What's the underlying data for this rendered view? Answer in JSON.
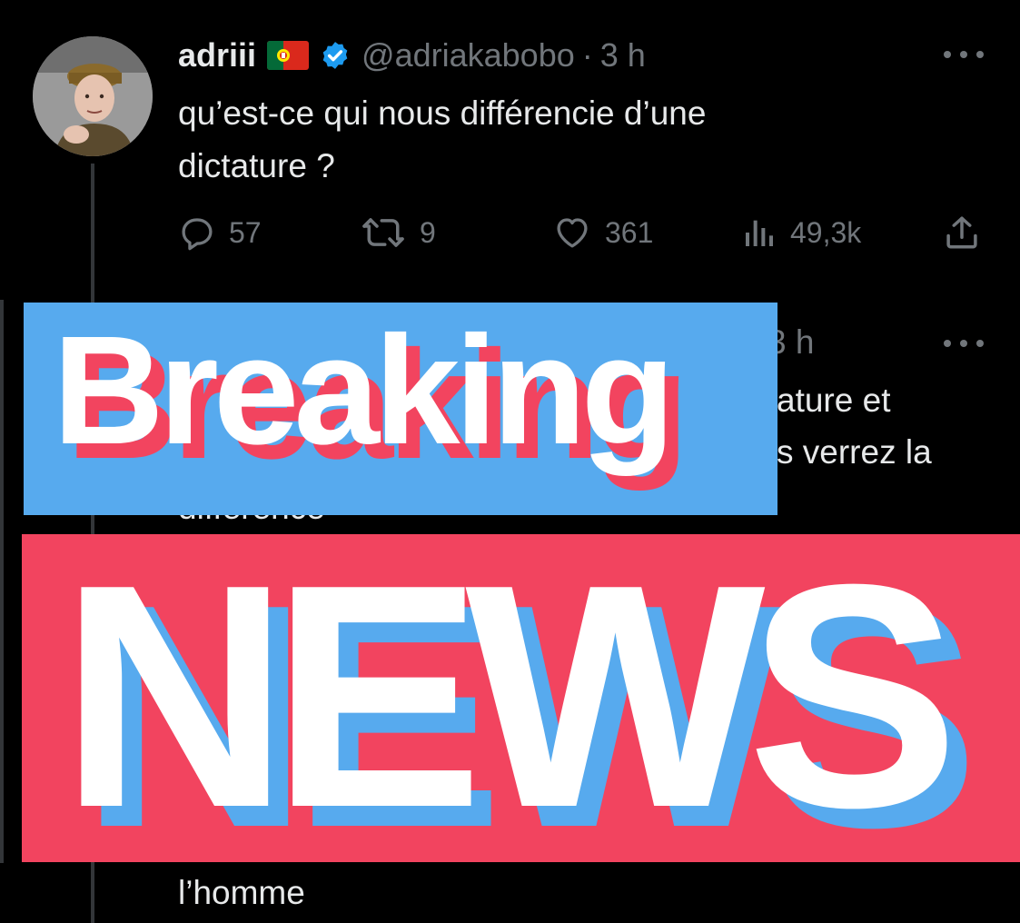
{
  "tweet1": {
    "display_name": "adriii",
    "flag_icon": "portugal-flag-icon",
    "verified_icon": "verified-badge-icon",
    "handle": "@adriakabobo",
    "separator": "·",
    "timestamp": "3 h",
    "text_line1": "qu’est-ce qui nous différencie d’une",
    "text_line2": "dictature ?",
    "actions": {
      "replies": "57",
      "reposts": "9",
      "likes": "361",
      "views": "49,3k"
    }
  },
  "tweet2": {
    "timestamp_partial": "3 h",
    "line1_partial": "ature et",
    "line2_partial": "s verrez la",
    "line3_partial": "différence",
    "last_line": "l’homme"
  },
  "overlay": {
    "breaking": "Breaking",
    "news": "NEWS"
  },
  "colors": {
    "background": "#000000",
    "text": "#e7e9ea",
    "muted": "#71767b",
    "verified": "#1d9bf0",
    "banner_blue": "#57aaee",
    "banner_red": "#f2445f"
  }
}
